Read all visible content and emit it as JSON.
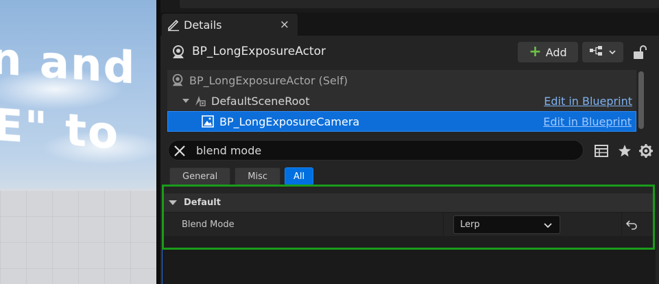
{
  "viewport": {
    "text_line1": "n and",
    "text_line2": "E\" to"
  },
  "tab": {
    "title": "Details",
    "close_glyph": "×",
    "icon": "pencil-icon"
  },
  "actor": {
    "name": "BP_LongExposureActor",
    "icon": "actor-icon",
    "add_label": "Add",
    "add_icon": "plus-icon",
    "blueprint_icon": "blueprint-hierarchy-icon",
    "lock_icon": "unlock-icon"
  },
  "tree": {
    "items": [
      {
        "label": "BP_LongExposureActor (Self)",
        "edit": ""
      },
      {
        "label": "DefaultSceneRoot",
        "edit": "Edit in Blueprint"
      },
      {
        "label": "BP_LongExposureCamera",
        "edit": "Edit in Blueprint"
      }
    ]
  },
  "search": {
    "value": "blend mode",
    "clear_icon": "clear-icon"
  },
  "toolbar": {
    "table_icon": "table-view-icon",
    "favorite_icon": "star-icon",
    "settings_icon": "gear-icon"
  },
  "filters": {
    "items": [
      {
        "label": "General",
        "active": false
      },
      {
        "label": "Misc",
        "active": false
      },
      {
        "label": "All",
        "active": true
      }
    ]
  },
  "category": {
    "name": "Default"
  },
  "property": {
    "label": "Blend Mode",
    "value": "Lerp",
    "reset_icon": "reset-to-default-icon"
  },
  "colors": {
    "selection": "#0d6ed9",
    "active_filter": "#0070e0",
    "highlight_box": "#1a9c1a",
    "add_plus": "#6fbf47"
  }
}
